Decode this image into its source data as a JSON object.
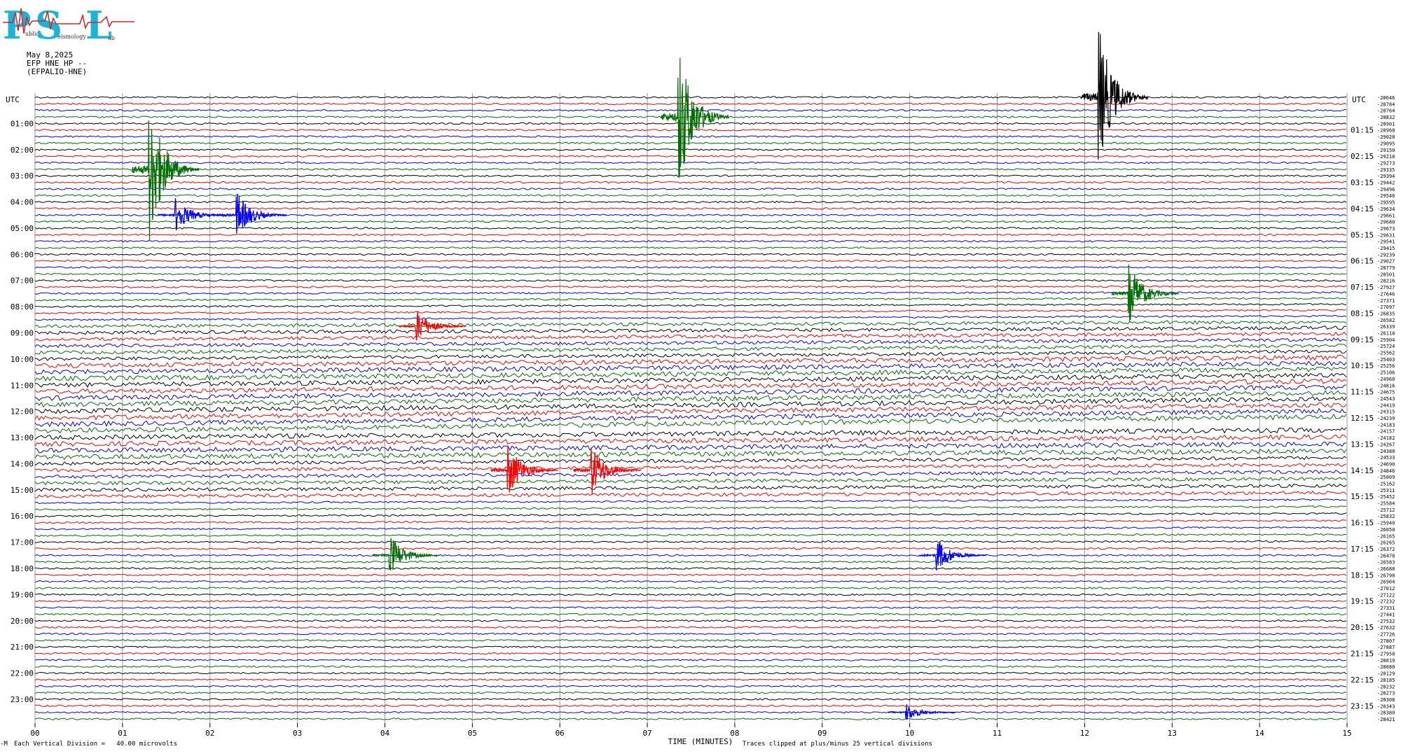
{
  "logo": {
    "letters": [
      "P",
      "S",
      "L"
    ],
    "word_fragments": [
      "ublic",
      "eismology",
      "ab"
    ]
  },
  "header": {
    "date": "May 8,2025",
    "station": "EFP HNE HP --",
    "site": "(EFPALIO-HNE)"
  },
  "footer": {
    "scale_note": "Each Vertical Division =   40.00 microvolts",
    "clip_note": "Traces clipped at plus/minus 25 vertical divisions",
    "corner_mark": "-M"
  },
  "chart_data": {
    "type": "line",
    "subtype": "helicorder",
    "xlabel": "TIME (MINUTES)",
    "x_ticks": [
      "00",
      "01",
      "02",
      "03",
      "04",
      "05",
      "06",
      "07",
      "08",
      "09",
      "10",
      "11",
      "12",
      "13",
      "14",
      "15"
    ],
    "xlim": [
      0,
      15
    ],
    "left_axis_label": "UTC",
    "right_axis_label": "UTC",
    "left_time_labels": [
      "01:00",
      "02:00",
      "03:00",
      "04:00",
      "05:00",
      "06:00",
      "07:00",
      "08:00",
      "09:00",
      "10:00",
      "11:00",
      "12:00",
      "13:00",
      "14:00",
      "15:00",
      "16:00",
      "17:00",
      "18:00",
      "19:00",
      "20:00",
      "21:00",
      "22:00",
      "23:00"
    ],
    "right_time_labels": [
      "01:15",
      "02:15",
      "03:15",
      "04:15",
      "05:15",
      "06:15",
      "07:15",
      "08:15",
      "09:15",
      "10:15",
      "11:15",
      "12:15",
      "13:15",
      "14:15",
      "15:15",
      "16:15",
      "17:15",
      "18:15",
      "19:15",
      "20:15",
      "21:15",
      "22:15",
      "23:15"
    ],
    "trace_count": 96,
    "trace_colors": [
      "#000000",
      "#ff0000",
      "#0000ff",
      "#007000"
    ],
    "trace_offsets": [
      "-28646",
      "-28784",
      "-28764",
      "-28832",
      "-28901",
      "-28968",
      "-29028",
      "-29095",
      "-29150",
      "-29218",
      "-29273",
      "-29335",
      "-29394",
      "-29442",
      "-29496",
      "-29546",
      "-29595",
      "-29634",
      "-29661",
      "-29680",
      "-29673",
      "-29631",
      "-29541",
      "-29415",
      "-29239",
      "-29027",
      "-28779",
      "-28501",
      "-28216",
      "-27927",
      "-27646",
      "-27371",
      "-27097",
      "-26835",
      "-26582",
      "-26339",
      "-26118",
      "-25904",
      "-25724",
      "-25562",
      "-25403",
      "-25256",
      "-25106",
      "-24960",
      "-24816",
      "-24675",
      "-24543",
      "-24419",
      "-24315",
      "-24239",
      "-24183",
      "-24157",
      "-24182",
      "-24267",
      "-24388",
      "-24533",
      "-24690",
      "-24846",
      "-25009",
      "-25162",
      "-25311",
      "-25452",
      "-25584",
      "-25712",
      "-25832",
      "-25940",
      "-26050",
      "-26165",
      "-26265",
      "-26372",
      "-26478",
      "-26583",
      "-26688",
      "-26798",
      "-26904",
      "-27012",
      "-27122",
      "-27232",
      "-27331",
      "-27441",
      "-27532",
      "-27632",
      "-27726",
      "-27807",
      "-27887",
      "-27958",
      "-28019",
      "-28080",
      "-28129",
      "-28185",
      "-28232",
      "-28273",
      "-28308",
      "-28343",
      "-28380",
      "-28421"
    ],
    "events": [
      {
        "trace": 3,
        "minute": 7.35,
        "amplitude": 25,
        "color": "#007000"
      },
      {
        "trace": 0,
        "minute": 12.15,
        "amplitude": 25,
        "color": "#000000"
      },
      {
        "trace": 11,
        "minute": 1.3,
        "amplitude": 25,
        "color": "#007000"
      },
      {
        "trace": 18,
        "minute": 2.3,
        "amplitude": 8,
        "color": "#0000ff"
      },
      {
        "trace": 18,
        "minute": 1.6,
        "amplitude": 6,
        "color": "#0000ff"
      },
      {
        "trace": 30,
        "minute": 12.5,
        "amplitude": 10,
        "color": "#007000"
      },
      {
        "trace": 35,
        "minute": 4.35,
        "amplitude": 6,
        "color": "#ff0000"
      },
      {
        "trace": 57,
        "minute": 5.4,
        "amplitude": 9,
        "color": "#ff0000"
      },
      {
        "trace": 57,
        "minute": 6.35,
        "amplitude": 9,
        "color": "#ff0000"
      },
      {
        "trace": 70,
        "minute": 4.05,
        "amplitude": 7,
        "color": "#007000"
      },
      {
        "trace": 70,
        "minute": 10.3,
        "amplitude": 6,
        "color": "#0000ff"
      },
      {
        "trace": 94,
        "minute": 9.95,
        "amplitude": 3,
        "color": "#0000ff"
      }
    ]
  }
}
